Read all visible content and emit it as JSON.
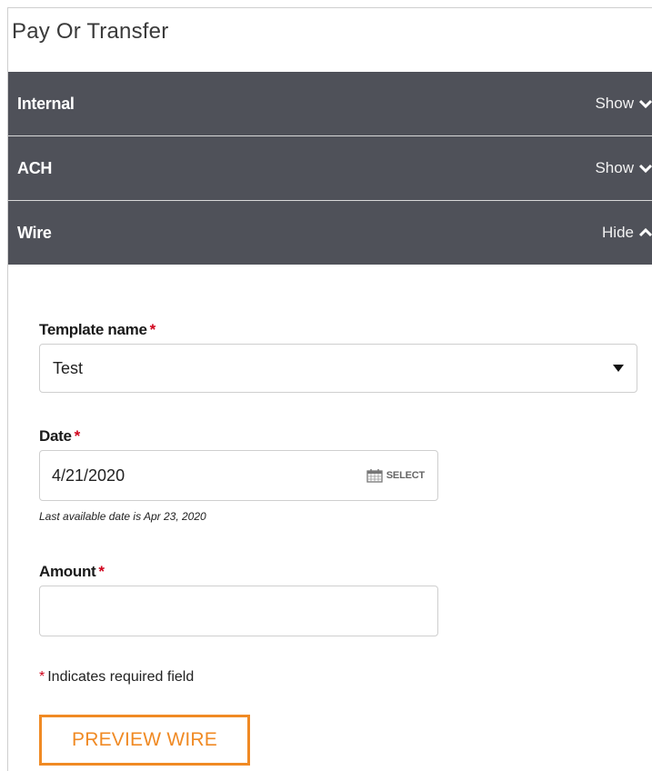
{
  "page": {
    "title": "Pay Or Transfer"
  },
  "sections": [
    {
      "title": "Internal",
      "toggle": "Show",
      "state": "collapsed"
    },
    {
      "title": "ACH",
      "toggle": "Show",
      "state": "collapsed"
    },
    {
      "title": "Wire",
      "toggle": "Hide",
      "state": "expanded"
    }
  ],
  "form": {
    "template": {
      "label": "Template name",
      "value": "Test"
    },
    "date": {
      "label": "Date",
      "value": "4/21/2020",
      "select_label": "SELECT",
      "hint": "Last available date is Apr 23, 2020"
    },
    "amount": {
      "label": "Amount",
      "value": "",
      "placeholder": ""
    },
    "required_marker": "*",
    "required_note": "Indicates required field",
    "submit_label": "PREVIEW WIRE"
  },
  "colors": {
    "accordion_bg": "#4f5159",
    "accent": "#f08a24",
    "required": "#d0021b"
  }
}
